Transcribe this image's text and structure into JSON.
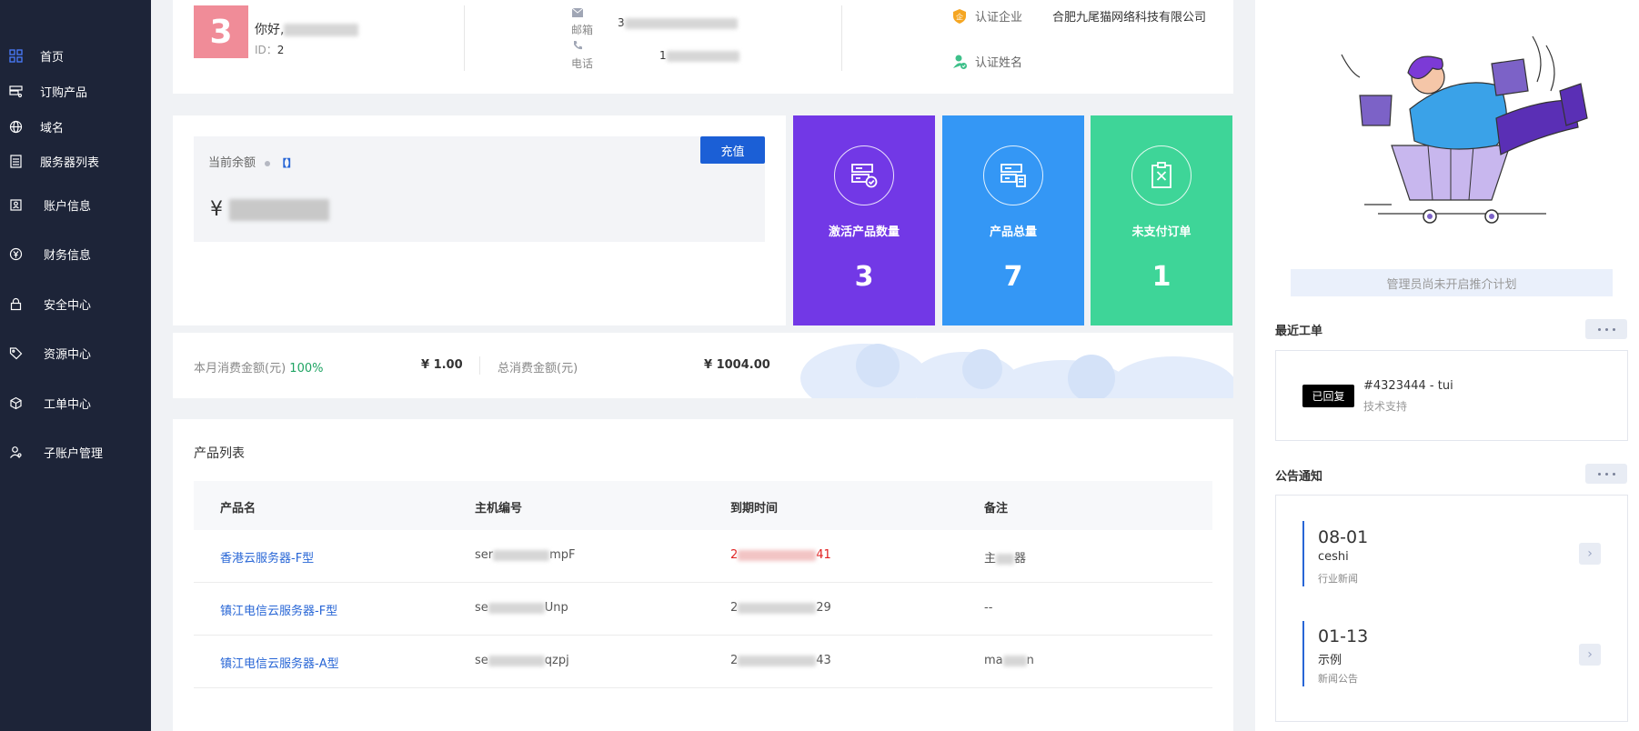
{
  "sidebar": {
    "items": [
      {
        "label": "首页",
        "icon": "grid-icon",
        "active": true
      },
      {
        "label": "订购产品",
        "icon": "server-cart-icon"
      },
      {
        "label": "域名",
        "icon": "globe-icon"
      },
      {
        "label": "服务器列表",
        "icon": "list-icon"
      },
      {
        "label": "账户信息",
        "icon": "id-card-icon"
      },
      {
        "label": "财务信息",
        "icon": "currency-icon"
      },
      {
        "label": "安全中心",
        "icon": "lock-icon"
      },
      {
        "label": "资源中心",
        "icon": "tag-icon"
      },
      {
        "label": "工单中心",
        "icon": "box-icon"
      },
      {
        "label": "子账户管理",
        "icon": "user-icon"
      }
    ]
  },
  "user": {
    "avatar_text": "3",
    "greeting": "你好,",
    "id_label": "ID：",
    "id_value": "2",
    "email_label": "邮箱",
    "email_prefix": "3",
    "phone_label": "电话",
    "phone_prefix": "1",
    "cert_company_label": "认证企业",
    "cert_name_label": "认证姓名",
    "company_name": "合肥九尾猫网络科技有限公司"
  },
  "balance": {
    "label": "当前余额",
    "recharge_label": "充值",
    "currency_symbol": "¥"
  },
  "stats": [
    {
      "label": "激活产品数量",
      "value": "3",
      "color": "#7238e6",
      "icon": "server-check-icon"
    },
    {
      "label": "产品总量",
      "value": "7",
      "color": "#3497f5",
      "icon": "server-doc-icon"
    },
    {
      "label": "未支付订单",
      "value": "1",
      "color": "#3ed598",
      "icon": "clipboard-x-icon"
    }
  ],
  "consumption": {
    "month_label": "本月消费金额(元)",
    "month_percent": "100%",
    "month_value": "¥  1.00",
    "total_label": "总消费金额(元)",
    "total_value": "¥  1004.00"
  },
  "products": {
    "title": "产品列表",
    "columns": [
      "产品名",
      "主机编号",
      "到期时间",
      "备注"
    ],
    "rows": [
      {
        "name": "香港云服务器-F型",
        "host_prefix": "ser",
        "host_suffix": "mpF",
        "expire_prefix": "2",
        "expire_suffix": "41",
        "note": "主",
        "note_suffix": "器"
      },
      {
        "name": "镇江电信云服务器-F型",
        "host_prefix": "se",
        "host_suffix": "Unp",
        "expire_prefix": "2",
        "expire_suffix": "29",
        "note": "--",
        "note_suffix": ""
      },
      {
        "name": "镇江电信云服务器-A型",
        "host_prefix": "se",
        "host_suffix": "qzpj",
        "expire_prefix": "2",
        "expire_suffix": "43",
        "note": "ma",
        "note_suffix": "n"
      }
    ]
  },
  "promo": {
    "text": "管理员尚未开启推介计划"
  },
  "tickets": {
    "title": "最近工单",
    "status": "已回复",
    "item_title": "#4323444 - tui",
    "item_sub": "技术支持"
  },
  "notices": {
    "title": "公告通知",
    "items": [
      {
        "date": "08-01",
        "name": "ceshi",
        "category": "行业新闻"
      },
      {
        "date": "01-13",
        "name": "示例",
        "category": "新闻公告"
      }
    ]
  },
  "colors": {
    "sidebar_bg": "#1d2438",
    "accent": "#1b5fd6",
    "avatar_bg": "#f08c98",
    "link": "#2866d6",
    "expire_red": "#e02020",
    "percent_green": "#1fa463"
  }
}
